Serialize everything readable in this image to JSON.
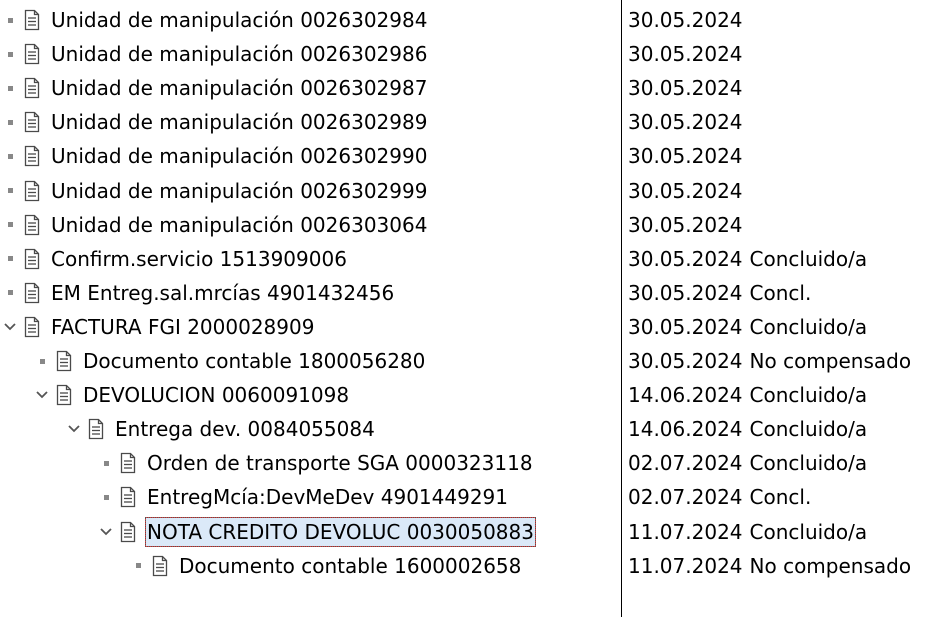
{
  "rows": [
    {
      "level": 0,
      "expander": "dot",
      "label": "Unidad de manipulación 0026302984",
      "date": "30.05.2024",
      "status": ""
    },
    {
      "level": 0,
      "expander": "dot",
      "label": "Unidad de manipulación 0026302986",
      "date": "30.05.2024",
      "status": ""
    },
    {
      "level": 0,
      "expander": "dot",
      "label": "Unidad de manipulación 0026302987",
      "date": "30.05.2024",
      "status": ""
    },
    {
      "level": 0,
      "expander": "dot",
      "label": "Unidad de manipulación 0026302989",
      "date": "30.05.2024",
      "status": ""
    },
    {
      "level": 0,
      "expander": "dot",
      "label": "Unidad de manipulación 0026302990",
      "date": "30.05.2024",
      "status": ""
    },
    {
      "level": 0,
      "expander": "dot",
      "label": "Unidad de manipulación 0026302999",
      "date": "30.05.2024",
      "status": ""
    },
    {
      "level": 0,
      "expander": "dot",
      "label": "Unidad de manipulación 0026303064",
      "date": "30.05.2024",
      "status": ""
    },
    {
      "level": 0,
      "expander": "dot",
      "label": "Confirm.servicio 1513909006",
      "date": "30.05.2024",
      "status": "Concluido/a"
    },
    {
      "level": 0,
      "expander": "dot",
      "label": "EM Entreg.sal.mrcías 4901432456",
      "date": "30.05.2024",
      "status": "Concl."
    },
    {
      "level": 0,
      "expander": "chevron-down",
      "label": "FACTURA FGI 2000028909",
      "date": "30.05.2024",
      "status": "Concluido/a"
    },
    {
      "level": 1,
      "expander": "dot",
      "label": "Documento contable 1800056280",
      "date": "30.05.2024",
      "status": "No compensado"
    },
    {
      "level": 1,
      "expander": "chevron-down",
      "label": "DEVOLUCION 0060091098",
      "date": "14.06.2024",
      "status": "Concluido/a"
    },
    {
      "level": 2,
      "expander": "chevron-down",
      "label": "Entrega dev. 0084055084",
      "date": "14.06.2024",
      "status": "Concluido/a"
    },
    {
      "level": 3,
      "expander": "dot",
      "label": "Orden de transporte SGA 0000323118",
      "date": "02.07.2024",
      "status": "Concluido/a"
    },
    {
      "level": 3,
      "expander": "dot",
      "label": "EntregMcía:DevMeDev 4901449291",
      "date": "02.07.2024",
      "status": "Concl."
    },
    {
      "level": 3,
      "expander": "chevron-down",
      "label": "NOTA CREDITO DEVOLUC 0030050883",
      "date": "11.07.2024",
      "status": "Concluido/a",
      "selected": true
    },
    {
      "level": 4,
      "expander": "dot",
      "label": "Documento contable 1600002658",
      "date": "11.07.2024",
      "status": "No compensado"
    }
  ]
}
